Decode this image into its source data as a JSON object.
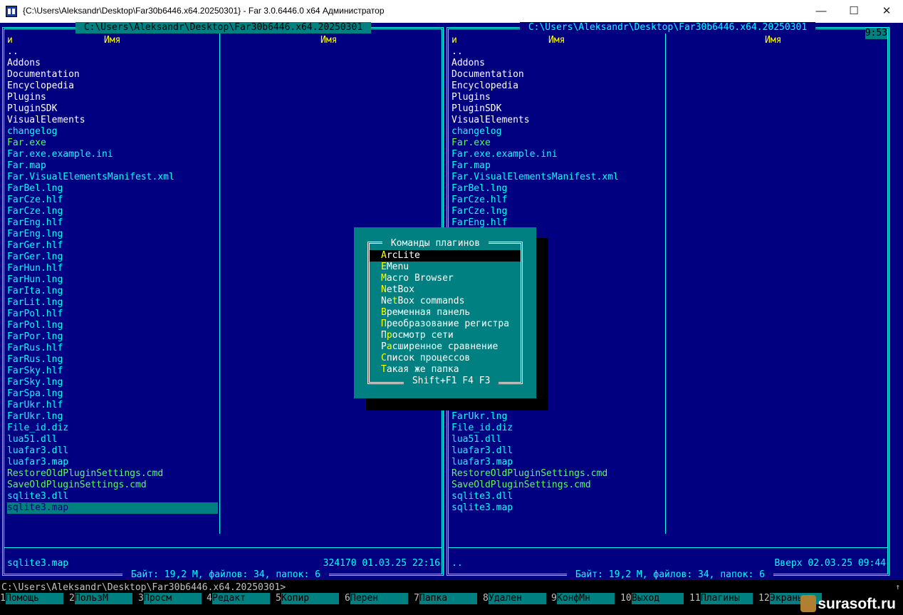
{
  "window": {
    "title": "{C:\\Users\\Aleksandr\\Desktop\\Far30b6446.x64.20250301} - Far 3.0.6446.0 x64 Администратор",
    "minimize": "—",
    "maximize": "☐",
    "close": "✕"
  },
  "left_panel": {
    "path": " C:\\Users\\Aleksandr\\Desktop\\Far30b6446.x64.20250301 ",
    "col_mark": "и",
    "col1": "Имя",
    "col2": "Имя",
    "files": [
      {
        "name": "..",
        "c": "w"
      },
      {
        "name": "Addons",
        "c": "w"
      },
      {
        "name": "Documentation",
        "c": "w"
      },
      {
        "name": "Encyclopedia",
        "c": "w"
      },
      {
        "name": "Plugins",
        "c": "w"
      },
      {
        "name": "PluginSDK",
        "c": "w"
      },
      {
        "name": "VisualElements",
        "c": "w"
      },
      {
        "name": "changelog",
        "c": "c"
      },
      {
        "name": "Far.exe",
        "c": "g"
      },
      {
        "name": "Far.exe.example.ini",
        "c": "c"
      },
      {
        "name": "Far.map",
        "c": "c"
      },
      {
        "name": "Far.VisualElementsManifest.xml",
        "c": "c"
      },
      {
        "name": "FarBel.lng",
        "c": "c"
      },
      {
        "name": "FarCze.hlf",
        "c": "c"
      },
      {
        "name": "FarCze.lng",
        "c": "c"
      },
      {
        "name": "FarEng.hlf",
        "c": "c"
      },
      {
        "name": "FarEng.lng",
        "c": "c"
      },
      {
        "name": "FarGer.hlf",
        "c": "c"
      },
      {
        "name": "FarGer.lng",
        "c": "c"
      },
      {
        "name": "FarHun.hlf",
        "c": "c"
      },
      {
        "name": "FarHun.lng",
        "c": "c"
      },
      {
        "name": "FarIta.lng",
        "c": "c"
      },
      {
        "name": "FarLit.lng",
        "c": "c"
      },
      {
        "name": "FarPol.hlf",
        "c": "c"
      },
      {
        "name": "FarPol.lng",
        "c": "c"
      },
      {
        "name": "FarPor.lng",
        "c": "c"
      },
      {
        "name": "FarRus.hlf",
        "c": "c"
      },
      {
        "name": "FarRus.lng",
        "c": "c"
      },
      {
        "name": "FarSky.hlf",
        "c": "c"
      },
      {
        "name": "FarSky.lng",
        "c": "c"
      },
      {
        "name": "FarSpa.lng",
        "c": "c"
      },
      {
        "name": "FarUkr.hlf",
        "c": "c"
      },
      {
        "name": "FarUkr.lng",
        "c": "c"
      },
      {
        "name": "File_id.diz",
        "c": "c"
      },
      {
        "name": "lua51.dll",
        "c": "c"
      },
      {
        "name": "luafar3.dll",
        "c": "c"
      },
      {
        "name": "luafar3.map",
        "c": "c"
      },
      {
        "name": "RestoreOldPluginSettings.cmd",
        "c": "g"
      },
      {
        "name": "SaveOldPluginSettings.cmd",
        "c": "g"
      },
      {
        "name": "sqlite3.dll",
        "c": "c"
      },
      {
        "name": "sqlite3.map",
        "c": "sel"
      }
    ],
    "info_name": "sqlite3.map",
    "info_meta": "324170 01.03.25 22:16",
    "status": " Байт: 19,2 М, файлов: 34, папок: 6 "
  },
  "right_panel": {
    "path": " C:\\Users\\Aleksandr\\Desktop\\Far30b6446.x64.20250301 ",
    "clock": "9:53",
    "col_mark": "и",
    "col1": "Имя",
    "col2": "Имя",
    "files_top": [
      {
        "name": "..",
        "c": "w"
      },
      {
        "name": "Addons",
        "c": "w"
      },
      {
        "name": "Documentation",
        "c": "w"
      },
      {
        "name": "Encyclopedia",
        "c": "w"
      },
      {
        "name": "Plugins",
        "c": "w"
      },
      {
        "name": "PluginSDK",
        "c": "w"
      },
      {
        "name": "VisualElements",
        "c": "w"
      },
      {
        "name": "changelog",
        "c": "c"
      },
      {
        "name": "Far.exe",
        "c": "g"
      },
      {
        "name": "Far.exe.example.ini",
        "c": "c"
      },
      {
        "name": "Far.map",
        "c": "c"
      },
      {
        "name": "Far.VisualElementsManifest.xml",
        "c": "c"
      },
      {
        "name": "FarBel.lng",
        "c": "c"
      },
      {
        "name": "FarCze.hlf",
        "c": "c"
      },
      {
        "name": "FarCze.lng",
        "c": "c"
      },
      {
        "name": "FarEng.hlf",
        "c": "c"
      }
    ],
    "files_bottom": [
      {
        "name": "FarUkr.hlf",
        "c": "c"
      },
      {
        "name": "FarUkr.lng",
        "c": "c"
      },
      {
        "name": "File_id.diz",
        "c": "c"
      },
      {
        "name": "lua51.dll",
        "c": "c"
      },
      {
        "name": "luafar3.dll",
        "c": "c"
      },
      {
        "name": "luafar3.map",
        "c": "c"
      },
      {
        "name": "RestoreOldPluginSettings.cmd",
        "c": "g"
      },
      {
        "name": "SaveOldPluginSettings.cmd",
        "c": "g"
      },
      {
        "name": "sqlite3.dll",
        "c": "c"
      },
      {
        "name": "sqlite3.map",
        "c": "c"
      }
    ],
    "info_name": "..",
    "info_meta": "Вверх 02.03.25 09:44",
    "status": " Байт: 19,2 М, файлов: 34, папок: 6 "
  },
  "plugin_menu": {
    "title": " Команды плагинов ",
    "footer": " Shift+F1 F4 F3 ",
    "items": [
      {
        "hk": "A",
        "rest": "rcLite",
        "pre": "",
        "selected": true
      },
      {
        "hk": "E",
        "rest": "Menu",
        "pre": ""
      },
      {
        "hk": "M",
        "rest": "acro Browser",
        "pre": ""
      },
      {
        "hk": "N",
        "rest": "etBox",
        "pre": ""
      },
      {
        "hk": "t",
        "rest": "Box commands",
        "pre": "Ne"
      },
      {
        "hk": "В",
        "rest": "ременная панель",
        "pre": ""
      },
      {
        "hk": "П",
        "rest": "реобразование регистра",
        "pre": ""
      },
      {
        "hk": "р",
        "rest": "осмотр сети",
        "pre": "П"
      },
      {
        "hk": "а",
        "rest": "сширенное сравнение",
        "pre": "Р"
      },
      {
        "hk": "С",
        "rest": "писок процессов",
        "pre": ""
      },
      {
        "hk": "Т",
        "rest": "акая же папка",
        "pre": ""
      }
    ]
  },
  "command_line": "C:\\Users\\Aleksandr\\Desktop\\Far30b6446.x64.20250301>",
  "scroll_indicator": "↑",
  "keybar": [
    {
      "n": "1",
      "label": "Помощь"
    },
    {
      "n": "2",
      "label": "ПользМ"
    },
    {
      "n": "3",
      "label": "Просм"
    },
    {
      "n": "4",
      "label": "Редакт"
    },
    {
      "n": "5",
      "label": "Копир"
    },
    {
      "n": "6",
      "label": "Перен"
    },
    {
      "n": "7",
      "label": "Папка"
    },
    {
      "n": "8",
      "label": "Удален"
    },
    {
      "n": "9",
      "label": "КонфМн"
    },
    {
      "n": "10",
      "label": "Выход"
    },
    {
      "n": "11",
      "label": "Плагины"
    },
    {
      "n": "12",
      "label": "Экраны"
    }
  ],
  "watermark": "surasoft.ru"
}
